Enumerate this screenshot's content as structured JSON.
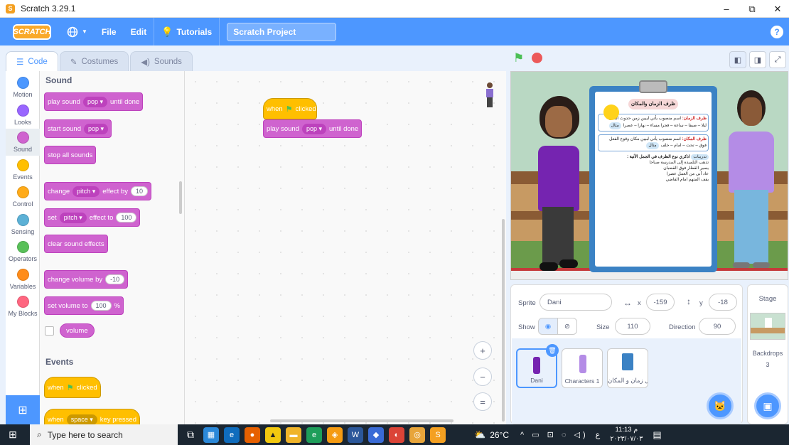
{
  "window": {
    "title": "Scratch 3.29.1",
    "minimize": "–",
    "maximize": "⧉",
    "close": "✕"
  },
  "menu": {
    "logo": "SCRATCH",
    "language_icon": "globe-icon",
    "file": "File",
    "edit": "Edit",
    "tutorials": "Tutorials",
    "project_title": "Scratch Project",
    "help": "?"
  },
  "tabs": {
    "code": "Code",
    "costumes": "Costumes",
    "sounds": "Sounds"
  },
  "categories": [
    {
      "label": "Motion",
      "color": "#4c97ff"
    },
    {
      "label": "Looks",
      "color": "#9966ff"
    },
    {
      "label": "Sound",
      "color": "#cf63cf"
    },
    {
      "label": "Events",
      "color": "#ffbf00"
    },
    {
      "label": "Control",
      "color": "#ffab19"
    },
    {
      "label": "Sensing",
      "color": "#5cb1d6"
    },
    {
      "label": "Operators",
      "color": "#59c059"
    },
    {
      "label": "Variables",
      "color": "#ff8c1a"
    },
    {
      "label": "My Blocks",
      "color": "#ff6680"
    }
  ],
  "palette": {
    "sound_heading": "Sound",
    "play_sound": {
      "text": "play sound",
      "value": "pop",
      "suffix": "until done"
    },
    "start_sound": {
      "text": "start sound",
      "value": "pop"
    },
    "stop_all": "stop all sounds",
    "change_effect": {
      "text": "change",
      "value": "pitch",
      "mid": "effect by",
      "num": "10"
    },
    "set_effect": {
      "text": "set",
      "value": "pitch",
      "mid": "effect to",
      "num": "100"
    },
    "clear_effects": "clear sound effects",
    "change_volume": {
      "text": "change volume by",
      "num": "-10"
    },
    "set_volume": {
      "text": "set volume to",
      "num": "100",
      "unit": "%"
    },
    "volume": "volume",
    "events_heading": "Events",
    "when_flag": {
      "text": "when",
      "suffix": "clicked"
    },
    "when_key": {
      "text": "when",
      "value": "space",
      "suffix": "key pressed"
    }
  },
  "script": {
    "hat": {
      "text": "when",
      "suffix": "clicked"
    },
    "play": {
      "text": "play sound",
      "value": "pop",
      "suffix": "until done"
    }
  },
  "zoom": {
    "in": "+",
    "out": "−",
    "reset": "="
  },
  "stage_text": {
    "title": "ظرف الزمان والمكان",
    "time_head": "ظرف الزمان:",
    "time_def": "اسم منصوب يأتي لبيين زمن حدوث الفعل",
    "time_examples": "ليلا – صيفا – ساعة – فجرا مساء – نهارا – عصرا",
    "example": "مثال",
    "place_head": "ظرف المكان:",
    "place_def": "اسم منصوب يأتي لبيين مكان وقوع الفعل",
    "place_examples": "فوق – تحت – امام – خلف",
    "exercise": "تدريبات",
    "exercise_q": "اذكري نوع الظرف في الجمل الآتية :",
    "s1": "تذهب التلميذة إلى المدرسة صباحا",
    "s2": "يسير القطار فوق القضبان",
    "s3": "عاد أبي من العمل عصرا",
    "s4": "يقف المتهم امام القاضي"
  },
  "sprite_info": {
    "sprite_label": "Sprite",
    "sprite_name": "Dani",
    "x_label": "x",
    "x": "-159",
    "y_label": "y",
    "y": "-18",
    "show_label": "Show",
    "size_label": "Size",
    "size": "110",
    "direction_label": "Direction",
    "direction": "90"
  },
  "sprites": [
    "Dani",
    "Characters 1",
    "ظرف ال زمان و المكان"
  ],
  "stage_panel": {
    "label": "Stage",
    "backdrops_label": "Backdrops",
    "backdrops_count": "3"
  },
  "taskbar": {
    "search_placeholder": "Type here to search",
    "temperature": "26°C",
    "time": "11:13 م",
    "date": "٢٠٢٣/٠٧/٠٣",
    "lang": "ع"
  }
}
